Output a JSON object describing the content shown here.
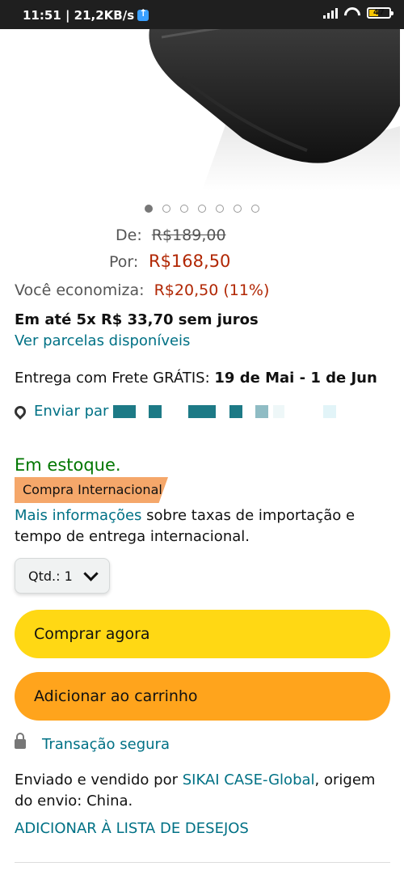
{
  "status_bar": {
    "time_speed": "11:51 | 21,2KB/s",
    "battery": "47"
  },
  "carousel": {
    "total_images": 7,
    "active_index": 0
  },
  "pricing": {
    "de_label": "De:",
    "de_value": "R$189,00",
    "por_label": "Por:",
    "por_value": "R$168,50",
    "save_label": "Você economiza:",
    "save_value": "R$20,50 (11%)",
    "installments": "Em até 5x R$ 33,70 sem juros",
    "installments_link": "Ver parcelas disponíveis"
  },
  "delivery": {
    "prefix": "Entrega com Frete GRÁTIS: ",
    "dates": "19 de Mai - 1 de Jun",
    "send_to": "Enviar par"
  },
  "stock": {
    "status": "Em estoque.",
    "badge": "Compra Internacional",
    "more_info_link": "Mais informações",
    "more_info_text": " sobre taxas de importação e tempo de entrega internacional."
  },
  "quantity": {
    "label": "Qtd.: 1"
  },
  "buttons": {
    "buy_now": "Comprar agora",
    "add_to_cart": "Adicionar ao carrinho"
  },
  "secure": {
    "label": "Transação segura"
  },
  "seller": {
    "prefix": "Enviado e vendido por ",
    "name": "SIKAI CASE-Global",
    "suffix": ", origem do envio: China."
  },
  "wishlist": {
    "label": "ADICIONAR À LISTA DE DESEJOS"
  },
  "colors": {
    "teal": "#007185",
    "price_red": "#b12704",
    "buy_button": "#ffd814",
    "cart_button": "#ffa41c"
  }
}
